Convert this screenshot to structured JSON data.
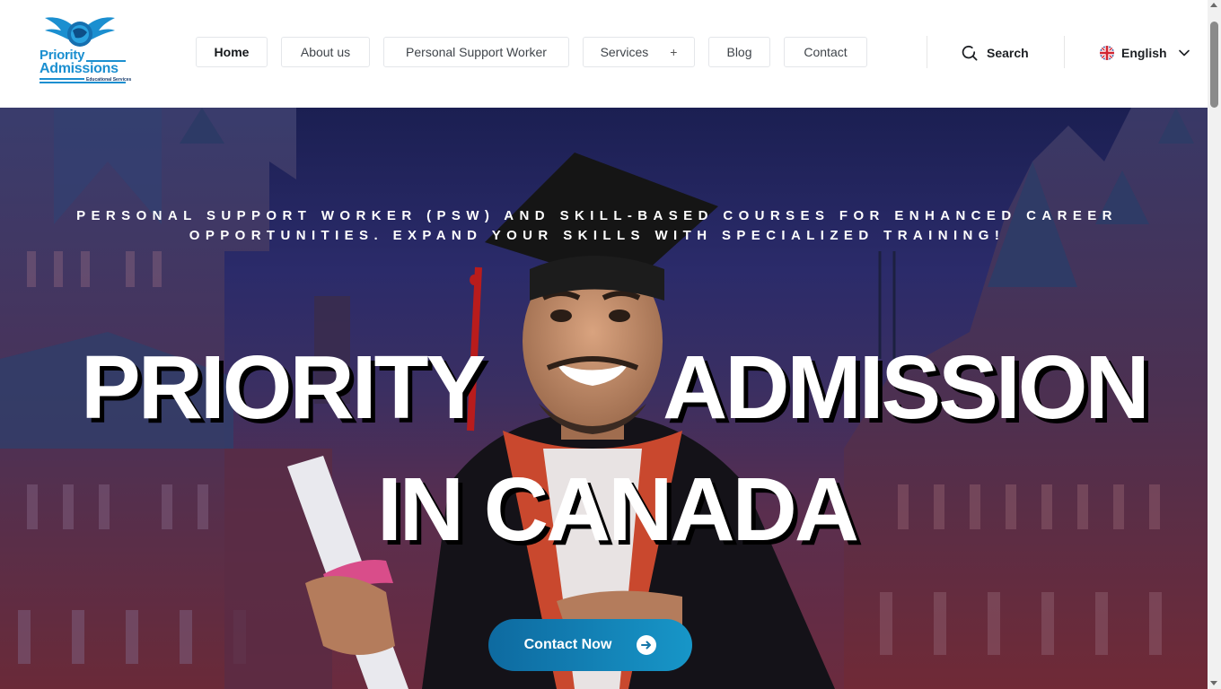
{
  "brand": {
    "line1": "Priority",
    "line2": "Admissions",
    "line3": "Educational Services"
  },
  "nav": {
    "items": [
      {
        "label": "Home",
        "active": true
      },
      {
        "label": "About us"
      },
      {
        "label": "Personal Support Worker"
      },
      {
        "label": "Services",
        "has_submenu": true,
        "submenu_icon": "+"
      },
      {
        "label": "Blog"
      },
      {
        "label": "Contact"
      }
    ]
  },
  "search": {
    "label": "Search",
    "icon": "search-icon"
  },
  "language": {
    "label": "English",
    "flag": "uk-flag-icon",
    "icon": "chevron-down-icon"
  },
  "hero": {
    "tagline_line1": "PERSONAL SUPPORT WORKER (PSW) AND SKILL-BASED COURSES FOR ENHANCED CAREER",
    "tagline_line2": "OPPORTUNITIES. EXPAND YOUR SKILLS WITH SPECIALIZED TRAINING!",
    "headline_word1": "PRIORITY",
    "headline_word2": "ADMISSION",
    "headline_line2": "IN CANADA",
    "cta_label": "Contact Now",
    "cta_icon": "arrow-right-circle-icon"
  },
  "colors": {
    "brand_blue": "#1b8fd0",
    "cta_start": "#0e6aa0",
    "cta_end": "#1796c8",
    "hero_dark": "#1b1f52"
  }
}
